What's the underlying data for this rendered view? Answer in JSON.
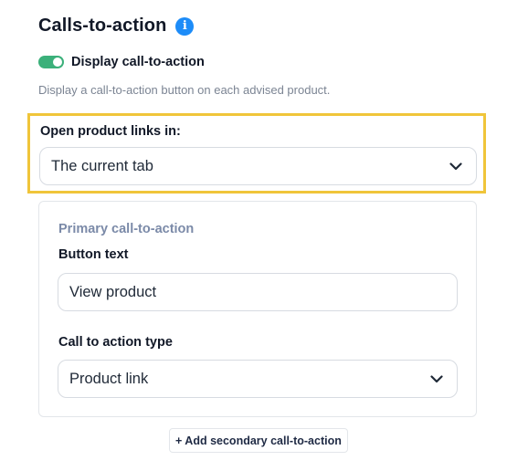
{
  "section": {
    "title": "Calls-to-action",
    "info_icon": "info-icon"
  },
  "toggle": {
    "label": "Display call-to-action",
    "enabled": true,
    "color_on": "#3bb07a"
  },
  "helper_text": "Display a call-to-action button on each advised product.",
  "product_links": {
    "label": "Open product links in:",
    "value": "The current tab",
    "highlight_color": "#f0c53a"
  },
  "primary_cta": {
    "subtitle": "Primary call-to-action",
    "button_text_label": "Button text",
    "button_text_value": "View product",
    "type_label": "Call to action type",
    "type_value": "Product link"
  },
  "add_secondary_label": "+ Add secondary call-to-action",
  "colors": {
    "accent_blue": "#1d8cf8",
    "subtitle": "#7b8aa8"
  }
}
